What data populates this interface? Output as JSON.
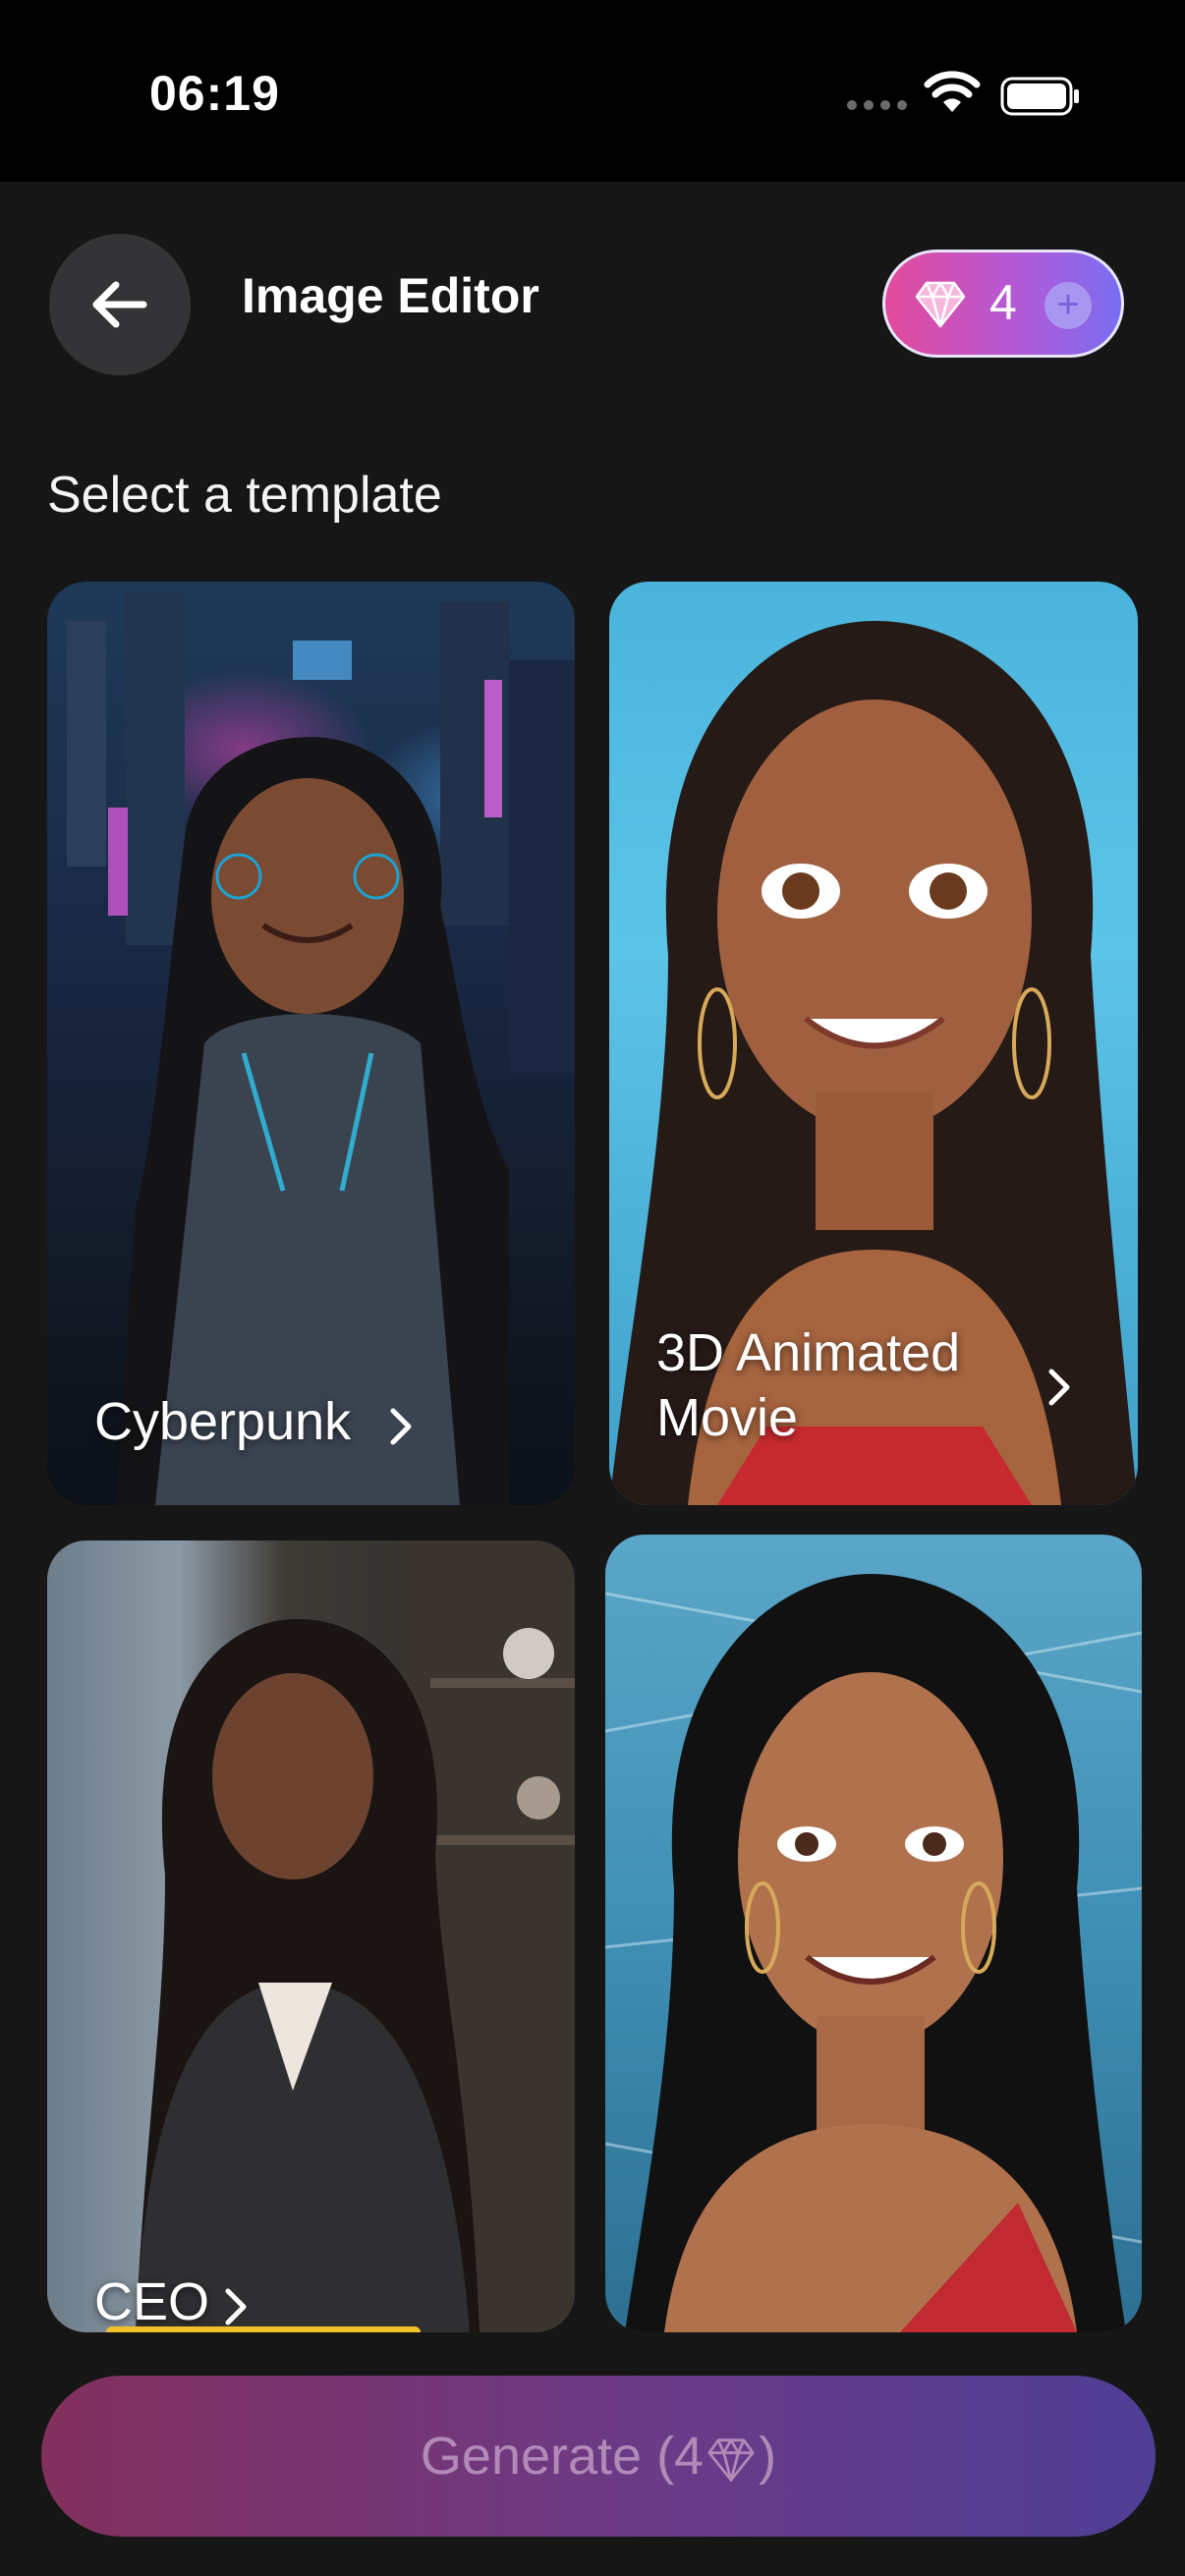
{
  "status_bar": {
    "time": "06:19"
  },
  "header": {
    "title": "Image Editor",
    "credits": "4"
  },
  "section": {
    "title": "Select a template"
  },
  "templates": [
    {
      "label": "Cyberpunk"
    },
    {
      "label_line1": "3D Animated",
      "label_line2": "Movie"
    },
    {
      "label": "CEO"
    },
    {
      "label": ""
    }
  ],
  "generate": {
    "label_prefix": "Generate (4",
    "label_suffix": ")"
  },
  "colors": {
    "accent_pink": "#e44a9a",
    "accent_purple": "#7b6df2",
    "background": "#161616"
  },
  "icons": [
    "back-arrow-icon",
    "gem-icon",
    "plus-icon",
    "chevron-right-icon",
    "wifi-icon",
    "battery-icon"
  ]
}
